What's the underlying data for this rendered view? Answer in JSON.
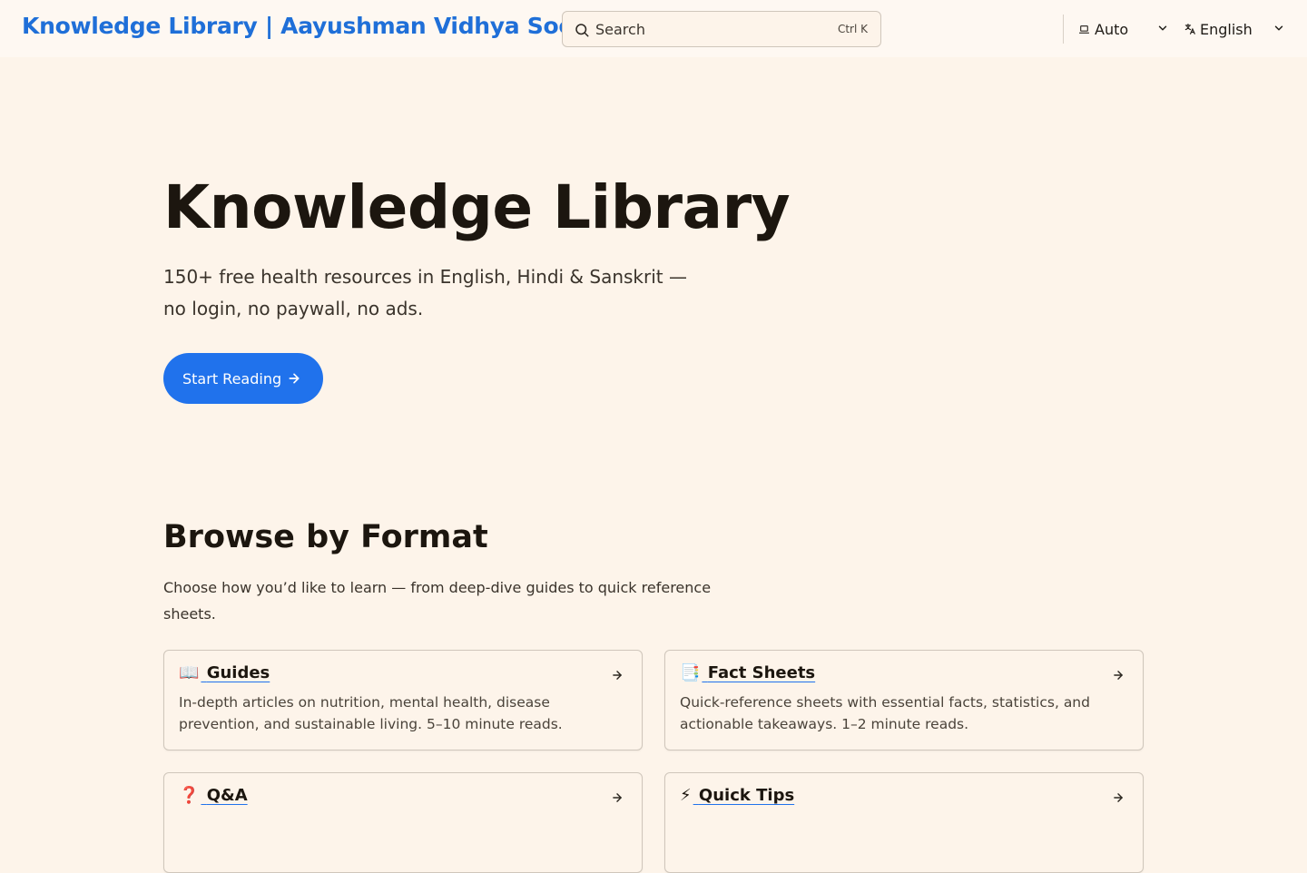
{
  "header": {
    "site_title": "Knowledge Library | Aayushman Vidhya Society",
    "search": {
      "placeholder": "Search",
      "shortcut": "Ctrl K"
    },
    "theme_select": {
      "value": "Auto",
      "icon": "laptop-icon"
    },
    "language_select": {
      "value": "English",
      "icon": "translate-icon"
    }
  },
  "hero": {
    "title": "Knowledge Library",
    "subtitle": "150+ free health resources in English, Hindi & Sanskrit — no login, no paywall, no ads.",
    "cta_label": "Start Reading"
  },
  "browse": {
    "title": "Browse by Format",
    "description": "Choose how you’d like to learn — from deep-dive guides to quick reference sheets.",
    "cards": [
      {
        "emoji": "📖",
        "title": "Guides",
        "description": "In-depth articles on nutrition, mental health, disease prevention, and sustainable living. 5–10 minute reads."
      },
      {
        "emoji": "📑",
        "title": "Fact Sheets",
        "description": "Quick-reference sheets with essential facts, statistics, and actionable takeaways. 1–2 minute reads."
      },
      {
        "emoji": "❓",
        "title": "Q&A",
        "description": ""
      },
      {
        "emoji": "⚡",
        "title": "Quick Tips",
        "description": ""
      }
    ]
  },
  "colors": {
    "background": "#fdf4ea",
    "accent": "#2072ec",
    "brand_title": "#1f6fd8"
  }
}
